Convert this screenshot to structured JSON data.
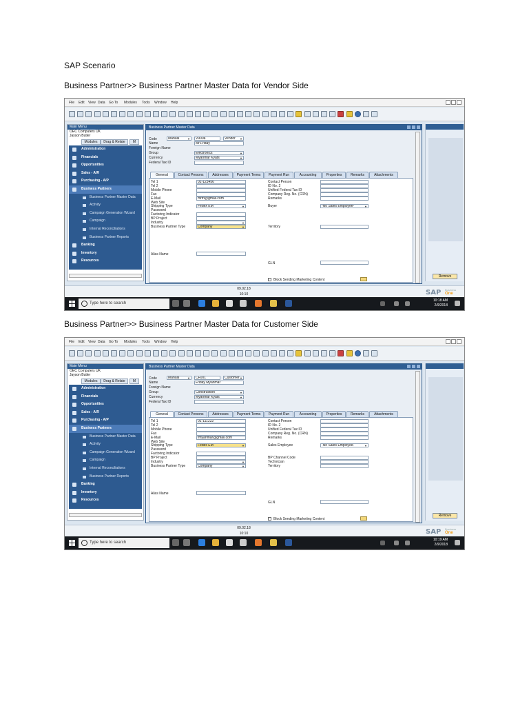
{
  "doc_title": "SAP Scenario",
  "sections": [
    {
      "title": "Business Partner>> Business Partner Master Data for Vendor Side",
      "menu": [
        "File",
        "Edit",
        "View",
        "Data",
        "Go To",
        "Modules",
        "Tools",
        "Window",
        "Help"
      ],
      "main_menu": {
        "header": "Main Menu",
        "company": "OEC Computers UK",
        "user": "Jayson Butler",
        "tabs": [
          "Modules",
          "Drag & Relate",
          "M"
        ],
        "items": [
          {
            "label": "Administration",
            "kind": "item"
          },
          {
            "label": "Financials",
            "kind": "item"
          },
          {
            "label": "Opportunities",
            "kind": "item"
          },
          {
            "label": "Sales - A/R",
            "kind": "item"
          },
          {
            "label": "Purchasing - A/P",
            "kind": "item"
          },
          {
            "label": "Business Partners",
            "kind": "active"
          },
          {
            "label": "Business Partner Master Data",
            "kind": "sub"
          },
          {
            "label": "Activity",
            "kind": "sub"
          },
          {
            "label": "Campaign Generation Wizard",
            "kind": "sub"
          },
          {
            "label": "Campaign",
            "kind": "sub"
          },
          {
            "label": "Internal Reconciliations",
            "kind": "sub"
          },
          {
            "label": "Business Partner Reports",
            "kind": "sub"
          },
          {
            "label": "Banking",
            "kind": "item"
          },
          {
            "label": "Inventory",
            "kind": "item"
          },
          {
            "label": "Resources",
            "kind": "item"
          }
        ]
      },
      "window_title": "Business Partner Master Data",
      "header_fields": {
        "code_label": "Code",
        "code_mode": "Manual",
        "code_value": "V900a",
        "type": "Vendor",
        "name_label": "Name",
        "name_value": "Mr.Friday",
        "foreign_label": "Foreign Name",
        "group_label": "Group",
        "group_value": "Electronics",
        "currency_label": "Currency",
        "currency_value": "Myanmar Kyats",
        "tax_label": "Federal Tax ID"
      },
      "tabs": [
        "General",
        "Contact Persons",
        "Addresses",
        "Payment Terms",
        "Payment Run",
        "Accounting",
        "Properties",
        "Remarks",
        "Attachments"
      ],
      "left_fields": [
        {
          "label": "Tel 1",
          "value": "01-123456"
        },
        {
          "label": "Tel 2",
          "value": ""
        },
        {
          "label": "Mobile Phone",
          "value": ""
        },
        {
          "label": "Fax",
          "value": ""
        },
        {
          "label": "E-Mail",
          "value": "mrfri@gmail.com"
        },
        {
          "label": "Web Site",
          "value": ""
        },
        {
          "label": "Shipping Type",
          "value": "Fedex EM"
        },
        {
          "label": "Password",
          "value": ""
        },
        {
          "label": "Factoring Indicator",
          "value": ""
        },
        {
          "label": "BP Project",
          "value": ""
        },
        {
          "label": "Industry",
          "value": ""
        },
        {
          "label": "Business Partner Type",
          "value": "Company"
        }
      ],
      "right_fields": [
        {
          "label": "Contact Person",
          "value": ""
        },
        {
          "label": "ID No. 2",
          "value": ""
        },
        {
          "label": "Unified Federal Tax ID",
          "value": ""
        },
        {
          "label": "Company Reg. No. (CRN)",
          "value": ""
        },
        {
          "label": "Remarks",
          "value": ""
        },
        {
          "label": "",
          "value": ""
        },
        {
          "label": "Buyer",
          "value": "-No Sales Employee-"
        },
        {
          "label": "",
          "value": ""
        },
        {
          "label": "",
          "value": ""
        },
        {
          "label": "",
          "value": ""
        },
        {
          "label": "",
          "value": ""
        },
        {
          "label": "Territory",
          "value": ""
        }
      ],
      "alias_label": "Alias Name",
      "gln_label": "GLN",
      "marketing_label": "Block Sending Marketing Content",
      "remove_label": "Remove",
      "status_date": "09.02.18",
      "status_time": "10:10",
      "search_placeholder": "Type here to search",
      "clock_time": "10:18 AM",
      "clock_date": "2/9/2018"
    },
    {
      "title": "Business Partner>> Business Partner Master Data for Customer Side",
      "menu": [
        "File",
        "Edit",
        "View",
        "Data",
        "Go To",
        "Modules",
        "Tools",
        "Window",
        "Help"
      ],
      "main_menu": {
        "header": "Main Menu",
        "company": "OEC Computers UK",
        "user": "Jayson Butler",
        "tabs": [
          "Modules",
          "Drag & Relate",
          "M"
        ],
        "items": [
          {
            "label": "Administration",
            "kind": "item"
          },
          {
            "label": "Financials",
            "kind": "item"
          },
          {
            "label": "Opportunities",
            "kind": "item"
          },
          {
            "label": "Sales - A/R",
            "kind": "item"
          },
          {
            "label": "Purchasing - A/P",
            "kind": "item"
          },
          {
            "label": "Business Partners",
            "kind": "active"
          },
          {
            "label": "Business Partner Master Data",
            "kind": "sub"
          },
          {
            "label": "Activity",
            "kind": "sub"
          },
          {
            "label": "Campaign Generation Wizard",
            "kind": "sub"
          },
          {
            "label": "Campaign",
            "kind": "sub"
          },
          {
            "label": "Internal Reconciliations",
            "kind": "sub"
          },
          {
            "label": "Business Partner Reports",
            "kind": "sub"
          },
          {
            "label": "Banking",
            "kind": "item"
          },
          {
            "label": "Inventory",
            "kind": "item"
          },
          {
            "label": "Resources",
            "kind": "item"
          }
        ]
      },
      "window_title": "Business Partner Master Data",
      "header_fields": {
        "code_label": "Code",
        "code_mode": "Manual",
        "code_value": "CF001",
        "type": "Customer",
        "name_label": "Name",
        "name_value": "Friday Myanmar",
        "foreign_label": "Foreign Name",
        "group_label": "Group",
        "group_value": "Construction",
        "currency_label": "Currency",
        "currency_value": "Myanmar Kyats",
        "tax_label": "Federal Tax ID"
      },
      "tabs": [
        "General",
        "Contact Persons",
        "Addresses",
        "Payment Terms",
        "Payment Run",
        "Accounting",
        "Properties",
        "Remarks",
        "Attachments"
      ],
      "left_fields": [
        {
          "label": "Tel 1",
          "value": "01-111222"
        },
        {
          "label": "Tel 2",
          "value": ""
        },
        {
          "label": "Mobile Phone",
          "value": ""
        },
        {
          "label": "Fax",
          "value": ""
        },
        {
          "label": "E-Mail",
          "value": "fmyanmar@gmail.com"
        },
        {
          "label": "Web Site",
          "value": ""
        },
        {
          "label": "Shipping Type",
          "value": "Fedex EM"
        },
        {
          "label": "Password",
          "value": ""
        },
        {
          "label": "Factoring Indicator",
          "value": ""
        },
        {
          "label": "BP Project",
          "value": ""
        },
        {
          "label": "Industry",
          "value": ""
        },
        {
          "label": "Business Partner Type",
          "value": "Company"
        }
      ],
      "right_fields": [
        {
          "label": "Contact Person",
          "value": ""
        },
        {
          "label": "ID No. 2",
          "value": ""
        },
        {
          "label": "Unified Federal Tax ID",
          "value": ""
        },
        {
          "label": "Company Reg. No. (CRN)",
          "value": ""
        },
        {
          "label": "Remarks",
          "value": ""
        },
        {
          "label": "",
          "value": ""
        },
        {
          "label": "Sales Employee",
          "value": "-No Sales Employee-"
        },
        {
          "label": "",
          "value": ""
        },
        {
          "label": "",
          "value": ""
        },
        {
          "label": "BP Channel Code",
          "value": ""
        },
        {
          "label": "Technician",
          "value": ""
        },
        {
          "label": "Territory",
          "value": ""
        }
      ],
      "alias_label": "Alias Name",
      "gln_label": "GLN",
      "marketing_label": "Block Sending Marketing Content",
      "remove_label": "Remove",
      "status_date": "09.02.18",
      "status_time": "10:10",
      "search_placeholder": "Type here to search",
      "clock_time": "10:19 AM",
      "clock_date": "2/9/2018"
    }
  ]
}
